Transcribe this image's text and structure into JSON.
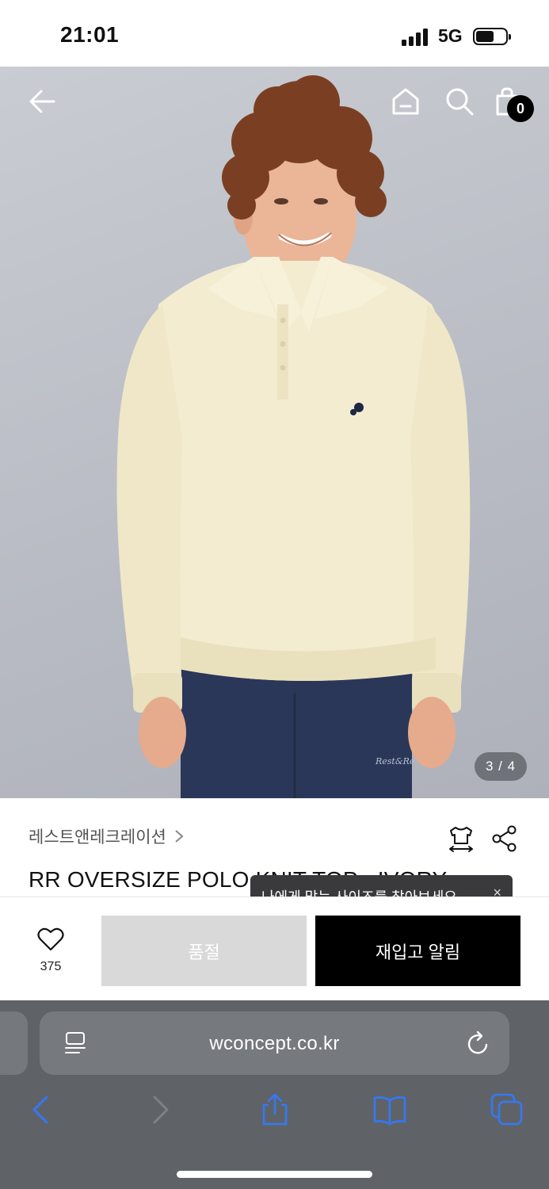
{
  "status_bar": {
    "time": "21:01",
    "network": "5G"
  },
  "header": {
    "back_icon": "arrow-left-icon",
    "home_icon": "home-icon",
    "search_icon": "search-icon",
    "cart_icon": "shopping-bag-icon",
    "cart_count": "0"
  },
  "gallery": {
    "counter": "3 / 4"
  },
  "product": {
    "brand": "레스트앤레크레이션",
    "title": "RR OVERSIZE POLO KNIT TOP - IVORY",
    "size_tip": "나에게 맞는 사이즈를 찾아보세요",
    "size_tip_close": "×"
  },
  "purchase": {
    "like_count": "375",
    "soldout_label": "품절",
    "restock_label": "재입고 알림"
  },
  "browser": {
    "url": "wconcept.co.kr"
  },
  "colors": {
    "sweater": "#f3ecd0",
    "pants": "#2b3758",
    "ios_blue": "#3478f6",
    "safari_bg": "#5f6368"
  }
}
